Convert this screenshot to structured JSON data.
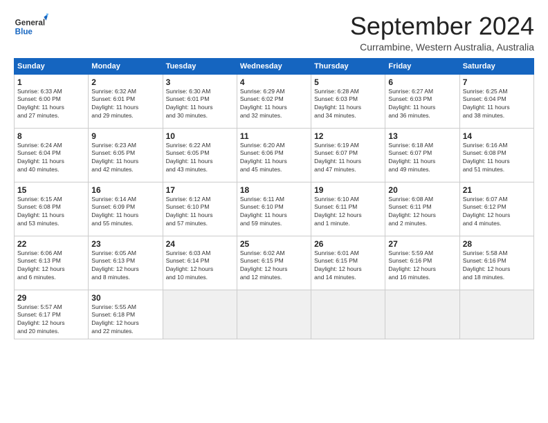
{
  "header": {
    "logo_general": "General",
    "logo_blue": "Blue",
    "month_title": "September 2024",
    "subtitle": "Currambine, Western Australia, Australia"
  },
  "calendar": {
    "days_of_week": [
      "Sunday",
      "Monday",
      "Tuesday",
      "Wednesday",
      "Thursday",
      "Friday",
      "Saturday"
    ],
    "weeks": [
      [
        {
          "day": "",
          "empty": true
        },
        {
          "day": "",
          "empty": true
        },
        {
          "day": "",
          "empty": true
        },
        {
          "day": "",
          "empty": true
        },
        {
          "day": "",
          "empty": true
        },
        {
          "day": "",
          "empty": true
        },
        {
          "day": "",
          "empty": true
        }
      ]
    ],
    "cells": [
      {
        "num": "1",
        "info": "Sunrise: 6:33 AM\nSunset: 6:00 PM\nDaylight: 11 hours\nand 27 minutes."
      },
      {
        "num": "2",
        "info": "Sunrise: 6:32 AM\nSunset: 6:01 PM\nDaylight: 11 hours\nand 29 minutes."
      },
      {
        "num": "3",
        "info": "Sunrise: 6:30 AM\nSunset: 6:01 PM\nDaylight: 11 hours\nand 30 minutes."
      },
      {
        "num": "4",
        "info": "Sunrise: 6:29 AM\nSunset: 6:02 PM\nDaylight: 11 hours\nand 32 minutes."
      },
      {
        "num": "5",
        "info": "Sunrise: 6:28 AM\nSunset: 6:03 PM\nDaylight: 11 hours\nand 34 minutes."
      },
      {
        "num": "6",
        "info": "Sunrise: 6:27 AM\nSunset: 6:03 PM\nDaylight: 11 hours\nand 36 minutes."
      },
      {
        "num": "7",
        "info": "Sunrise: 6:25 AM\nSunset: 6:04 PM\nDaylight: 11 hours\nand 38 minutes."
      },
      {
        "num": "8",
        "info": "Sunrise: 6:24 AM\nSunset: 6:04 PM\nDaylight: 11 hours\nand 40 minutes."
      },
      {
        "num": "9",
        "info": "Sunrise: 6:23 AM\nSunset: 6:05 PM\nDaylight: 11 hours\nand 42 minutes."
      },
      {
        "num": "10",
        "info": "Sunrise: 6:22 AM\nSunset: 6:05 PM\nDaylight: 11 hours\nand 43 minutes."
      },
      {
        "num": "11",
        "info": "Sunrise: 6:20 AM\nSunset: 6:06 PM\nDaylight: 11 hours\nand 45 minutes."
      },
      {
        "num": "12",
        "info": "Sunrise: 6:19 AM\nSunset: 6:07 PM\nDaylight: 11 hours\nand 47 minutes."
      },
      {
        "num": "13",
        "info": "Sunrise: 6:18 AM\nSunset: 6:07 PM\nDaylight: 11 hours\nand 49 minutes."
      },
      {
        "num": "14",
        "info": "Sunrise: 6:16 AM\nSunset: 6:08 PM\nDaylight: 11 hours\nand 51 minutes."
      },
      {
        "num": "15",
        "info": "Sunrise: 6:15 AM\nSunset: 6:08 PM\nDaylight: 11 hours\nand 53 minutes."
      },
      {
        "num": "16",
        "info": "Sunrise: 6:14 AM\nSunset: 6:09 PM\nDaylight: 11 hours\nand 55 minutes."
      },
      {
        "num": "17",
        "info": "Sunrise: 6:12 AM\nSunset: 6:10 PM\nDaylight: 11 hours\nand 57 minutes."
      },
      {
        "num": "18",
        "info": "Sunrise: 6:11 AM\nSunset: 6:10 PM\nDaylight: 11 hours\nand 59 minutes."
      },
      {
        "num": "19",
        "info": "Sunrise: 6:10 AM\nSunset: 6:11 PM\nDaylight: 12 hours\nand 1 minute."
      },
      {
        "num": "20",
        "info": "Sunrise: 6:08 AM\nSunset: 6:11 PM\nDaylight: 12 hours\nand 2 minutes."
      },
      {
        "num": "21",
        "info": "Sunrise: 6:07 AM\nSunset: 6:12 PM\nDaylight: 12 hours\nand 4 minutes."
      },
      {
        "num": "22",
        "info": "Sunrise: 6:06 AM\nSunset: 6:13 PM\nDaylight: 12 hours\nand 6 minutes."
      },
      {
        "num": "23",
        "info": "Sunrise: 6:05 AM\nSunset: 6:13 PM\nDaylight: 12 hours\nand 8 minutes."
      },
      {
        "num": "24",
        "info": "Sunrise: 6:03 AM\nSunset: 6:14 PM\nDaylight: 12 hours\nand 10 minutes."
      },
      {
        "num": "25",
        "info": "Sunrise: 6:02 AM\nSunset: 6:15 PM\nDaylight: 12 hours\nand 12 minutes."
      },
      {
        "num": "26",
        "info": "Sunrise: 6:01 AM\nSunset: 6:15 PM\nDaylight: 12 hours\nand 14 minutes."
      },
      {
        "num": "27",
        "info": "Sunrise: 5:59 AM\nSunset: 6:16 PM\nDaylight: 12 hours\nand 16 minutes."
      },
      {
        "num": "28",
        "info": "Sunrise: 5:58 AM\nSunset: 6:16 PM\nDaylight: 12 hours\nand 18 minutes."
      },
      {
        "num": "29",
        "info": "Sunrise: 5:57 AM\nSunset: 6:17 PM\nDaylight: 12 hours\nand 20 minutes."
      },
      {
        "num": "30",
        "info": "Sunrise: 5:55 AM\nSunset: 6:18 PM\nDaylight: 12 hours\nand 22 minutes."
      }
    ]
  }
}
